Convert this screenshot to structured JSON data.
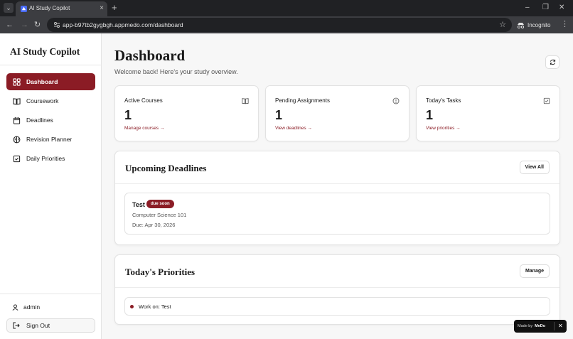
{
  "browser": {
    "tab_title": "AI Study Copilot",
    "tab_close": "×",
    "new_tab": "+",
    "url_host": "app-b97tb2gygbgh.appmedo.com",
    "url_path": "/dashboard",
    "incognito_label": "Incognito",
    "controls": {
      "minimize": "–",
      "restore": "❐",
      "close": "✕"
    }
  },
  "sidebar": {
    "app_title": "AI Study Copilot",
    "items": [
      {
        "label": "Dashboard",
        "icon": "grid-icon",
        "active": true
      },
      {
        "label": "Coursework",
        "icon": "book-icon",
        "active": false
      },
      {
        "label": "Deadlines",
        "icon": "calendar-icon",
        "active": false
      },
      {
        "label": "Revision Planner",
        "icon": "brain-icon",
        "active": false
      },
      {
        "label": "Daily Priorities",
        "icon": "checkbox-icon",
        "active": false
      }
    ],
    "user": "admin",
    "sign_out": "Sign Out"
  },
  "header": {
    "title": "Dashboard",
    "subtitle": "Welcome back! Here's your study overview."
  },
  "stats": [
    {
      "label": "Active Courses",
      "value": "1",
      "link": "Manage courses →",
      "icon": "book-icon"
    },
    {
      "label": "Pending Assignments",
      "value": "1",
      "link": "View deadlines →",
      "icon": "alert-circle-icon"
    },
    {
      "label": "Today's Tasks",
      "value": "1",
      "link": "View priorities →",
      "icon": "checkbox-icon"
    }
  ],
  "deadlines": {
    "title": "Upcoming Deadlines",
    "button": "View All",
    "items": [
      {
        "name": "Test",
        "badge": "due soon",
        "course": "Computer Science 101",
        "due": "Due: Apr 30, 2026"
      }
    ]
  },
  "priorities": {
    "title": "Today's Priorities",
    "button": "Manage",
    "items": [
      {
        "label": "Work on: Test"
      }
    ]
  },
  "made_by": {
    "prefix": "Made by",
    "brand": "MeDo",
    "close": "✕"
  },
  "colors": {
    "accent": "#8b1c25",
    "chrome_dark": "#202124",
    "chrome_mid": "#3c3d41",
    "page_bg": "#f7f7f7"
  }
}
